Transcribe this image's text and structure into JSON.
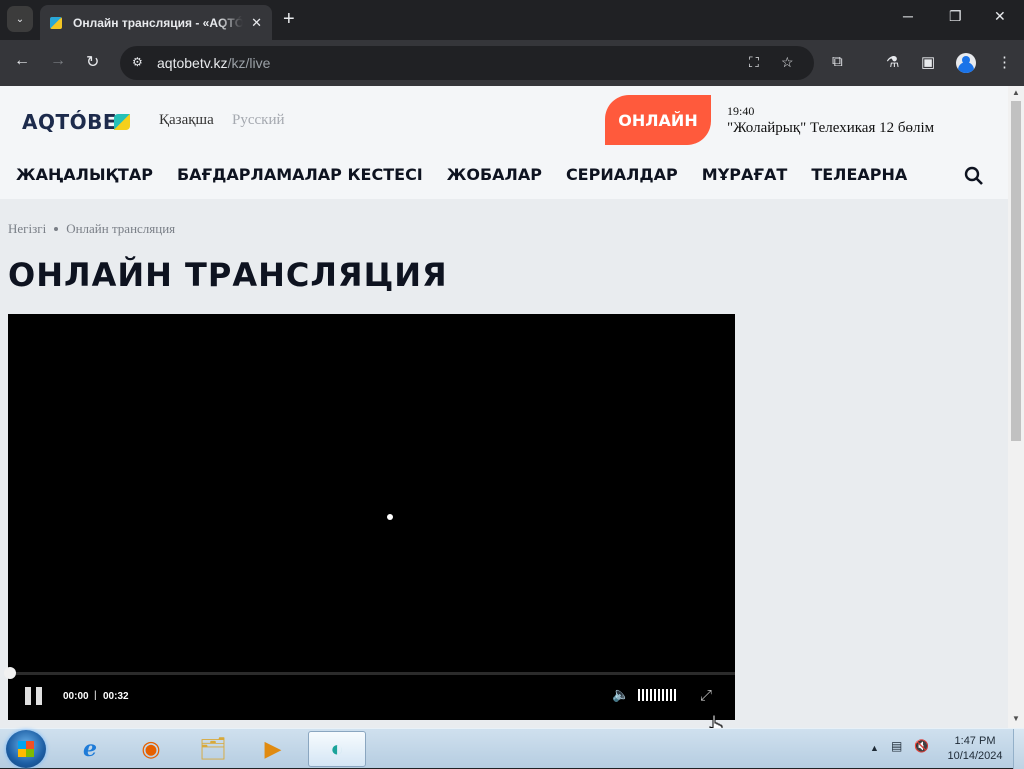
{
  "browser": {
    "tab_title": "Онлайн трансляция - «AQTÓBE",
    "url_host": "aqtobetv.kz",
    "url_path": "/kz/live",
    "icons": {
      "tab_list": "chevron-down-icon",
      "close": "close-icon",
      "new_tab": "plus-icon",
      "back": "back-arrow-icon",
      "forward": "forward-arrow-icon",
      "reload": "reload-icon",
      "site_info": "tune-icon",
      "translate": "translate-icon",
      "bookmark": "star-icon",
      "extensions": "puzzle-icon",
      "labs": "flask-icon",
      "side_panel": "side-panel-icon",
      "profile": "profile-icon",
      "menu": "kebab-menu-icon"
    },
    "controls": {
      "tab_list": "⌄",
      "tab_close": "✕",
      "new_tab": "+",
      "back": "←",
      "forward": "→",
      "reload": "↻",
      "site_info": "⚙",
      "translate": "⛶",
      "bookmark": "☆",
      "extensions": "⧉",
      "labs": "⚗",
      "side_panel": "▣",
      "menu": "⋮",
      "minimize": "─",
      "restore": "❐",
      "close": "✕"
    }
  },
  "site": {
    "logo_text": "AQTÓBE",
    "lang_kz": "Қазақша",
    "lang_ru": "Русский",
    "online_button": "ОНЛАЙН",
    "now_playing_time": "19:40",
    "now_playing_title": "\"Жолайрық\" Телехикая 12 бөлім",
    "nav": [
      "ЖАҢАЛЫҚТАР",
      "БАҒДАРЛАМАЛАР КЕСТЕСІ",
      "ЖОБАЛАР",
      "СЕРИАЛДАР",
      "МҰРАҒАТ",
      "ТЕЛЕАРНА"
    ],
    "breadcrumb_home": "Негізгі",
    "breadcrumb_current": "Онлайн трансляция",
    "page_title": "ОНЛАЙН ТРАНСЛЯЦИЯ",
    "accent_color": "#ff5a3c"
  },
  "player": {
    "current_time": "00:00",
    "separator": "|",
    "duration": "00:32",
    "progress_fraction": 0,
    "volume_level": 1.0,
    "icons": {
      "play_pause": "pause-icon",
      "mute": "speaker-muted-icon",
      "volume": "volume-bars-icon",
      "fullscreen": "fullscreen-icon"
    }
  },
  "scrollbar": {
    "up": "▲",
    "down": "▼"
  },
  "taskbar": {
    "apps": [
      "internet-explorer-icon",
      "firefox-icon",
      "file-explorer-icon",
      "media-player-icon",
      "active-app-icon"
    ],
    "app_glyphs": [
      "e",
      "◉",
      "🗂",
      "▶",
      "◐"
    ],
    "tray_arrow": "▲",
    "tray_icons": [
      "network-icon",
      "speaker-muted-icon"
    ],
    "tray_glyphs": [
      "▤",
      "🔇"
    ],
    "time": "1:47 PM",
    "date": "10/14/2024"
  }
}
